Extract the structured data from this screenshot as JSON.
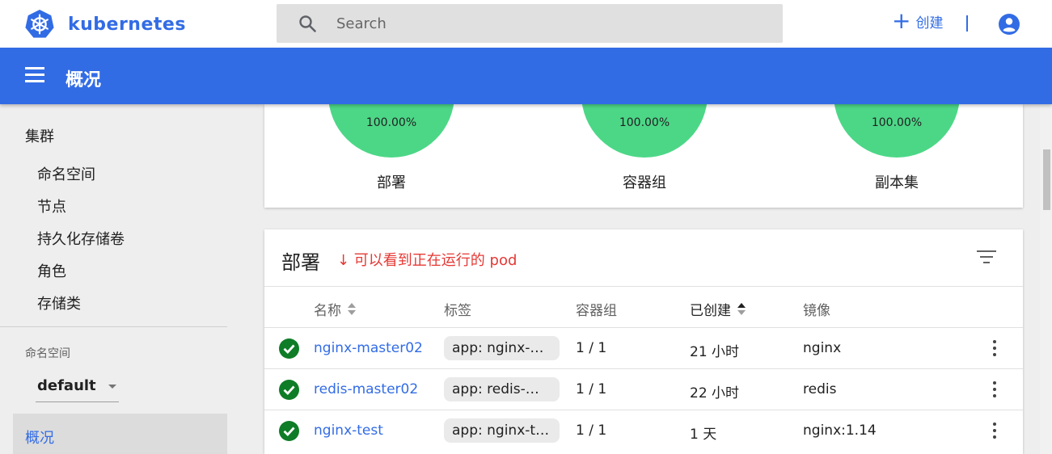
{
  "app": {
    "brand": "kubernetes",
    "brand_color": "#326ce5"
  },
  "topbar": {
    "search_placeholder": "Search",
    "create_label": "创建",
    "create_icon": "plus-icon",
    "account_icon": "account-circle-icon"
  },
  "header": {
    "title": "概况",
    "menu_icon": "hamburger-menu-icon"
  },
  "sidebar": {
    "cluster_heading": "集群",
    "cluster_items": [
      "命名空间",
      "节点",
      "持久化存储卷",
      "角色",
      "存储类"
    ],
    "namespace_label": "命名空间",
    "namespace_value": "default",
    "active_item": "概况"
  },
  "status": {
    "pie_color": "#4cd787",
    "items": [
      {
        "percent": "100.00%",
        "caption": "部署"
      },
      {
        "percent": "100.00%",
        "caption": "容器组"
      },
      {
        "percent": "100.00%",
        "caption": "副本集"
      }
    ]
  },
  "deployments": {
    "title": "部署",
    "annotation": "↓ 可以看到正在运行的 pod",
    "annotation_color": "#e53935",
    "columns": [
      "名称",
      "标签",
      "容器组",
      "已创建",
      "镜像"
    ],
    "rows": [
      {
        "name": "nginx-master02",
        "label": "app: nginx-mast...",
        "pods": "1 / 1",
        "created": "21 小时",
        "image": "nginx"
      },
      {
        "name": "redis-master02",
        "label": "app: redis-mast...",
        "pods": "1 / 1",
        "created": "22 小时",
        "image": "redis"
      },
      {
        "name": "nginx-test",
        "label": "app: nginx-test",
        "pods": "1 / 1",
        "created": "1 天",
        "image": "nginx:1.14"
      }
    ]
  }
}
